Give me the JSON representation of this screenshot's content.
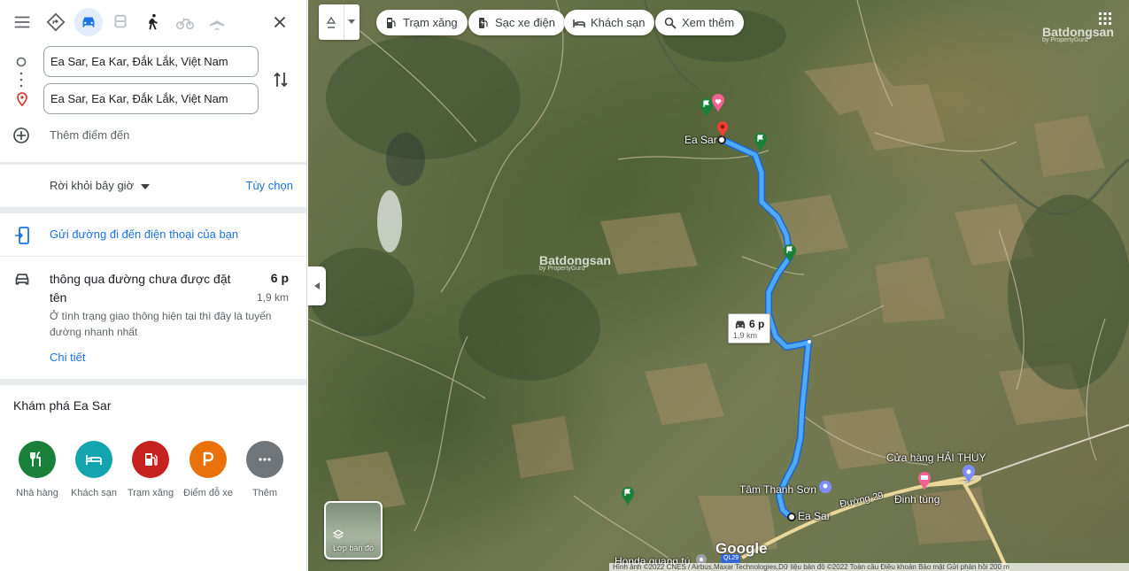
{
  "panel": {
    "origin_value": "Ea Sar, Ea Kar, Đắk Lắk, Việt Nam",
    "destination_value": "Ea Sar, Ea Kar, Đắk Lắk, Việt Nam",
    "add_destination": "Thêm điểm đến",
    "depart_label": "Rời khỏi bây giờ",
    "options_label": "Tùy chọn",
    "send_to_phone": "Gửi đường đi đến điện thoại của bạn",
    "route": {
      "via": "thông qua đường chưa được đặt tên",
      "time": "6 p",
      "distance": "1,9 km",
      "note": "Ở tình trạng giao thông hiện tại thì đây là tuyến đường nhanh nhất",
      "details": "Chi tiết"
    },
    "explore_title": "Khám phá Ea Sar",
    "categories": [
      {
        "label": "Nhà hàng",
        "color": "#188038"
      },
      {
        "label": "Khách sạn",
        "color": "#12a4af"
      },
      {
        "label": "Trạm xăng",
        "color": "#c5221f"
      },
      {
        "label": "Điểm đỗ xe",
        "color": "#e8710a"
      },
      {
        "label": "Thêm",
        "color": "#70757a"
      }
    ],
    "travel_modes": [
      "best-icon",
      "car-icon",
      "transit-icon",
      "walk-icon",
      "bike-icon",
      "flight-icon"
    ]
  },
  "map": {
    "chips": [
      "Trạm xăng",
      "Sạc xe điện",
      "Khách sạn",
      "Xem thêm"
    ],
    "labels": {
      "ea_sar_top": "Ea Sar",
      "ea_sar_bottom": "Ea Sar",
      "cua_hang": "Cửa hàng HẢI THÚY",
      "tam_thanh_son": "Tâm Thanh Sơn",
      "duong29": "Đường 29",
      "dinh_tung": "Đinh tùng",
      "honda": "Honda quang tú",
      "ql": "QL29"
    },
    "route_bubble": {
      "time": "6 p",
      "distance": "1,9 km"
    },
    "layer_label": "Lớp bản đồ",
    "google": "Google",
    "watermark": "Batdongsan",
    "watermark_sub": "by PropertyGuru",
    "footer": "Hình ảnh ©2022 CNES / Airbus,Maxar Technologies,Dữ liệu bản đồ ©2022   Toàn cầu   Điều khoản   Bảo mật   Gửi phản hồi   200 m",
    "route_color": "#4fa9f7"
  }
}
